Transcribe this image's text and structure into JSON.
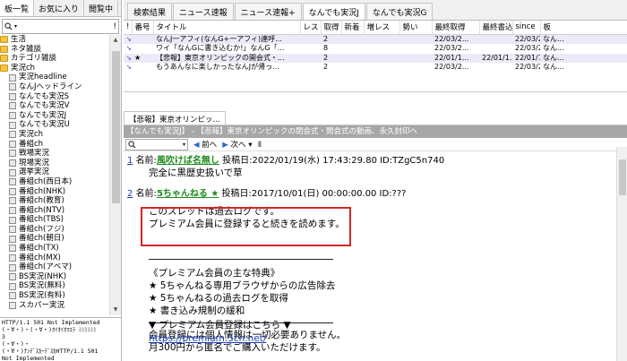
{
  "left_tabs": [
    "板一覧",
    "お気に入り",
    "閲覧中"
  ],
  "left_search": {
    "icon": "search-icon",
    "caret": "▾",
    "excl": "!"
  },
  "tree": [
    {
      "type": "folder",
      "label": "生活"
    },
    {
      "type": "folder",
      "label": "ネタ雑談"
    },
    {
      "type": "folder",
      "label": "カテゴリ雑談"
    },
    {
      "type": "folder",
      "label": "実況ch"
    },
    {
      "type": "board",
      "label": "実況headline"
    },
    {
      "type": "board",
      "label": "なんJヘッドライン"
    },
    {
      "type": "board",
      "label": "なんでも実況S"
    },
    {
      "type": "board",
      "label": "なんでも実況V"
    },
    {
      "type": "board",
      "label": "なんでも実況J"
    },
    {
      "type": "board",
      "label": "なんでも実況U"
    },
    {
      "type": "board",
      "label": "実況ch"
    },
    {
      "type": "board",
      "label": "番組ch"
    },
    {
      "type": "board",
      "label": "戦場実況"
    },
    {
      "type": "board",
      "label": "現場実況"
    },
    {
      "type": "board",
      "label": "選挙実況"
    },
    {
      "type": "board",
      "label": "番組ch(西日本)"
    },
    {
      "type": "board",
      "label": "番組ch(NHK)"
    },
    {
      "type": "board",
      "label": "番組ch(教育)"
    },
    {
      "type": "board",
      "label": "番組ch(NTV)"
    },
    {
      "type": "board",
      "label": "番組ch(TBS)"
    },
    {
      "type": "board",
      "label": "番組ch(フジ)"
    },
    {
      "type": "board",
      "label": "番組ch(朝日)"
    },
    {
      "type": "board",
      "label": "番組ch(TX)"
    },
    {
      "type": "board",
      "label": "番組ch(MX)"
    },
    {
      "type": "board",
      "label": "番組ch(アベマ)"
    },
    {
      "type": "board",
      "label": "BS実況(NHK)"
    },
    {
      "type": "board",
      "label": "BS実況(無料)"
    },
    {
      "type": "board",
      "label": "BS実況(有料)"
    },
    {
      "type": "board",
      "label": "スカパー実況"
    }
  ],
  "log_lines": [
    "HTTP/1.1 501 Not Implemented",
    "(・∀・)・(・∀・)ｵｲｵｲｵﾏｴﾗ ﾐﾐﾐﾐﾐﾐ",
    "3",
    "(・∀・)・",
    "(・∀・)ﾅﾝﾃﾞｽｶｰﾃﾞｽｶHTTP/1.1 501",
    "Not Implemented"
  ],
  "right_tabs": [
    "検索結果",
    "ニュース速報",
    "ニュース速報+",
    "なんでも実況J",
    "なんでも実況G"
  ],
  "right_active_tab": 3,
  "thread_columns": [
    "!",
    "番号",
    "タイトル",
    "レス",
    "取得",
    "新着",
    "増レス",
    "勢い",
    "最終取得",
    "最終書込",
    "since",
    "板"
  ],
  "thread_rows": [
    {
      "mark": "",
      "num": "",
      "title": "なんJ一アフィ(なんG+一アフィ)連呼...",
      "res": "",
      "got": "2",
      "new": "",
      "inc": "",
      "ikioi": "",
      "last_get": "22/03/2...",
      "last_post": "",
      "since": "22/03/2...",
      "board": "なん..."
    },
    {
      "mark": "",
      "num": "",
      "title": "ワイ「なんGに書き込むか!」なんG「...",
      "res": "",
      "got": "8",
      "new": "",
      "inc": "",
      "ikioi": "",
      "last_get": "22/03/2...",
      "last_post": "",
      "since": "22/03/2...",
      "board": "なん..."
    },
    {
      "mark": "",
      "num": "★",
      "title": "【悲報】東京オリンピックの開会式・...",
      "res": "",
      "got": "2",
      "new": "",
      "inc": "",
      "ikioi": "",
      "last_get": "22/01/1...",
      "last_post": "22/01/1...",
      "since": "22/01/1...",
      "board": "なん..."
    },
    {
      "mark": "",
      "num": "",
      "title": "もうあんなに楽しかったなんJが帰っ...",
      "res": "",
      "got": "2",
      "new": "",
      "inc": "",
      "ikioi": "",
      "last_get": "22/03/2...",
      "last_post": "",
      "since": "22/03/2...",
      "board": "なん..."
    }
  ],
  "viewer_tab": "【悲報】東京オリンピッ...",
  "thread_path": "【なんでも実況J】 - 【悲報】東京オリンピックの閉会式・開会式の動画、永久封印へ",
  "toolbar": {
    "search_caret": "▾",
    "prev": "前へ",
    "next": "次へ",
    "pin": "▮"
  },
  "posts": [
    {
      "num": "1",
      "label": "名前:",
      "name": "風吹けば名無し",
      "after": "投稿日:2022/01/19(水) 17:43:29.80 ID:TZgC5n740",
      "body": "完全に黒歴史扱いで草"
    },
    {
      "num": "2",
      "label": "名前:",
      "name": "5ちゃんねる ★",
      "after": "投稿日:2017/10/01(日) 00:00:00.00 ID:???"
    }
  ],
  "post2_lines": {
    "warn1": "このスレッドは過去ログです。",
    "warn2": "プレミアム会員に登録すると続きを読めます。",
    "benefits_title": "《プレミアム会員の主な特典》",
    "b1": "★ 5ちゃんねる専用ブラウザからの広告除去",
    "b2": "★ 5ちゃんねるの過去ログを取得",
    "b3": "★ 書き込み規制の緩和",
    "info1": "会員登録には個人情報は一切必要ありません。",
    "info2": "月300円から匿名でご購入いただけます。",
    "cta": "▼ プレミアム会員登録はこちら ▼",
    "url": "https://premium.5ch.net/"
  }
}
